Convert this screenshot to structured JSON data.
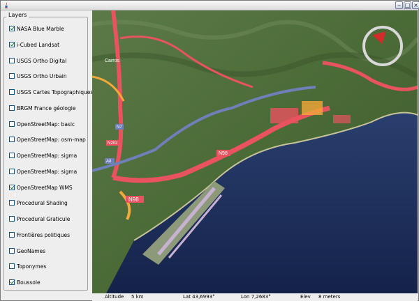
{
  "window": {
    "minimize_glyph": "‒",
    "maximize_glyph": "□",
    "close_glyph": "×"
  },
  "layers_panel": {
    "title": "Layers",
    "items": [
      {
        "label": "NASA Blue Marble",
        "checked": true
      },
      {
        "label": "i-Cubed Landsat",
        "checked": true
      },
      {
        "label": "USGS Ortho Digital",
        "checked": false
      },
      {
        "label": "USGS Ortho Urbain",
        "checked": false
      },
      {
        "label": "USGS Cartes Topographiques",
        "checked": false
      },
      {
        "label": "BRGM France géologie",
        "checked": false
      },
      {
        "label": "OpenStreetMap: basic",
        "checked": false
      },
      {
        "label": "OpenStreetMap: osm-map",
        "checked": false
      },
      {
        "label": "OpenStreetMap: sigma",
        "checked": false
      },
      {
        "label": "OpenStreetMap: sigma",
        "checked": false
      },
      {
        "label": "OpenStreetMap WMS",
        "checked": true
      },
      {
        "label": "Procedural Shading",
        "checked": false
      },
      {
        "label": "Procedural Graticule",
        "checked": false
      },
      {
        "label": "Frontières politiques",
        "checked": false
      },
      {
        "label": "GeoNames",
        "checked": false
      },
      {
        "label": "Toponymes",
        "checked": false
      },
      {
        "label": "Boussole",
        "checked": true
      }
    ]
  },
  "map": {
    "road_labels": [
      "N98",
      "N98",
      "A8",
      "N7",
      "N202"
    ],
    "place_label": "Carros"
  },
  "status": {
    "altitude_label": "Altitude",
    "altitude_value": "5 km",
    "lat": "Lat 43,6993°",
    "lon": "Lon 7,2683°",
    "elev_label": "Elev",
    "elev_value": "8 meters"
  },
  "colors": {
    "road": "#e8535f",
    "motorway": "#6f7fb8",
    "secondary": "#f3a83a",
    "sea": "#1b2d55",
    "land": "#4d6a3a"
  }
}
